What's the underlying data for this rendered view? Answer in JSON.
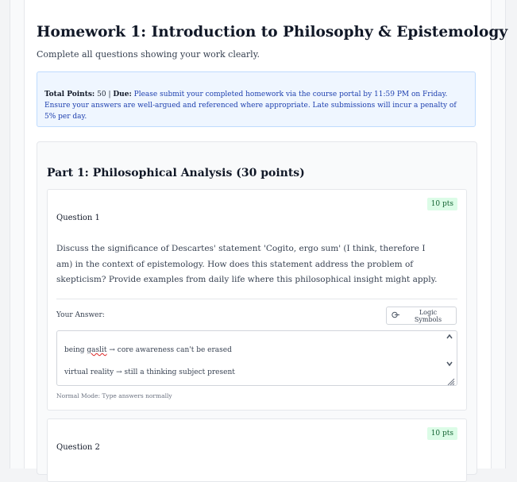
{
  "header": {
    "title": "Homework 1: Introduction to Philosophy & Epistemology",
    "subtitle": "Complete all questions showing your work clearly."
  },
  "notice": {
    "points_label": "Total Points:",
    "points_value": "50",
    "separator": "|",
    "due_label": "Due:",
    "due_text": "Please submit your completed homework via the course portal by 11:59 PM on Friday. Ensure your answers are well-argued and referenced where appropriate. Late submissions will incur a penalty of 5% per day."
  },
  "part1": {
    "title": "Part 1: Philosophical Analysis (30 points)",
    "questions": [
      {
        "points": "10 pts",
        "label": "Question 1",
        "text": "Discuss the significance of Descartes' statement 'Cogito, ergo sum' (I think, therefore I am) in the context of epistemology. How does this statement address the problem of skepticism? Provide examples from daily life where this philosophical insight might apply.",
        "answer_label": "Your Answer:",
        "logic_button": "Logic Symbols",
        "answer_lines": {
          "line1_word": "being",
          "line1_misspelled": "gaslit",
          "line1_rest": "→ core awareness can't be erased",
          "line2": "virtual reality → still a thinking subject present"
        },
        "mode_hint": "Normal Mode: Type answers normally"
      },
      {
        "points": "10 pts",
        "label": "Question 2"
      }
    ]
  },
  "icons": {
    "logic": "link-icon",
    "scroll_up": "chevron-up-icon",
    "scroll_down": "chevron-down-icon",
    "resize": "resize-handle-icon"
  }
}
